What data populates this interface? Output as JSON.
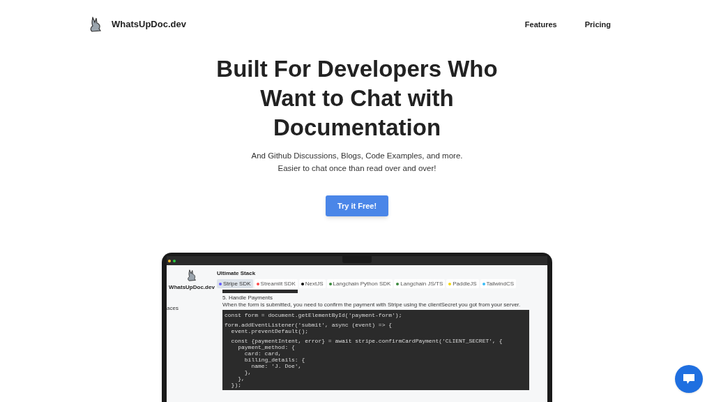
{
  "nav": {
    "brand": "WhatsUpDoc.dev",
    "links": [
      "Features",
      "Pricing"
    ]
  },
  "hero": {
    "title": "Built For Developers Who Want to Chat with Documentation",
    "subtitle_lines": [
      "And Github Discussions, Blogs, Code Examples, and more.",
      "Easier to chat once than read over and over!"
    ],
    "cta": "Try it Free!"
  },
  "app_preview": {
    "sidebar": {
      "brand": "WhatsUpDoc.dev",
      "items": [
        "aces"
      ]
    },
    "title": "Ultimate Stack",
    "tabs": [
      {
        "label": "Stripe SDK",
        "selected": true,
        "color": "#635bff"
      },
      {
        "label": "Streamlit SDK",
        "selected": false,
        "color": "#ff4b4b"
      },
      {
        "label": "NextJS",
        "selected": false,
        "color": "#000000"
      },
      {
        "label": "Langchain Python SDK",
        "selected": false,
        "color": "#3b8a3e"
      },
      {
        "label": "Langchain JS/TS",
        "selected": false,
        "color": "#3b8a3e"
      },
      {
        "label": "PaddleJS",
        "selected": false,
        "color": "#f5d90a"
      },
      {
        "label": "TailwindCS",
        "selected": false,
        "color": "#38bdf8"
      }
    ],
    "heading": "5. Handle Payments",
    "paragraph": "When the form is submitted, you need to confirm the payment with Stripe using the clientSecret you got from your server.",
    "code_groups": [
      [
        "const form = document.getElementById('payment-form');"
      ],
      [
        "form.addEventListener('submit', async (event) => {",
        "  event.preventDefault();"
      ],
      [
        "  const {paymentIntent, error} = await stripe.confirmCardPayment('CLIENT_SECRET', {",
        "    payment_method: {",
        "      card: card,",
        "      billing_details: {",
        "        name: 'J. Doe',",
        "      },",
        "    },",
        "  });"
      ]
    ]
  }
}
